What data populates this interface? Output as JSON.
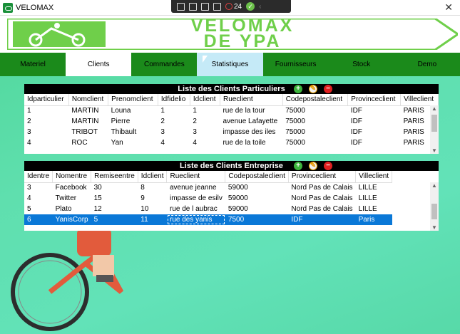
{
  "window": {
    "title": "VELOMAX",
    "close_label": "✕",
    "debug_count": "24"
  },
  "banner": {
    "line1": "VELOMAX",
    "line2": "DE YPA"
  },
  "nav": {
    "tabs": [
      {
        "label": "Materiel"
      },
      {
        "label": "Clients"
      },
      {
        "label": "Commandes"
      },
      {
        "label": "Statistiques"
      },
      {
        "label": "Fournisseurs"
      },
      {
        "label": "Stock"
      },
      {
        "label": "Demo"
      }
    ]
  },
  "particuliers": {
    "title": "Liste des Clients Particuliers",
    "columns": [
      "Idparticulier",
      "Nomclient",
      "Prenomclient",
      "Idfidelio",
      "Idclient",
      "Rueclient",
      "Codepostaleclient",
      "Provinceclient",
      "Villeclient"
    ],
    "rows": [
      [
        "1",
        "MARTIN",
        "Louna",
        "1",
        "1",
        "rue de la tour",
        "75000",
        "IDF",
        "PARIS"
      ],
      [
        "2",
        "MARTIN",
        "Pierre",
        "2",
        "2",
        "avenue Lafayette",
        "75000",
        "IDF",
        "PARIS"
      ],
      [
        "3",
        "TRIBOT",
        "Thibault",
        "3",
        "3",
        "impasse des iles",
        "75000",
        "IDF",
        "PARIS"
      ],
      [
        "4",
        "ROC",
        "Yan",
        "4",
        "4",
        "rue de la toile",
        "75000",
        "IDF",
        "PARIS"
      ]
    ]
  },
  "entreprises": {
    "title": "Liste des Clients Entreprise",
    "columns": [
      "Identre",
      "Nomentre",
      "Remiseentre",
      "Idclient",
      "Rueclient",
      "Codepostaleclient",
      "Provinceclient",
      "Villeclient"
    ],
    "rows": [
      [
        "3",
        "Facebook",
        "30",
        "8",
        "avenue jeanne",
        "59000",
        "Nord Pas de Calais",
        "LILLE"
      ],
      [
        "4",
        "Twitter",
        "15",
        "9",
        "impasse de esilv",
        "59000",
        "Nord Pas de Calais",
        "LILLE"
      ],
      [
        "5",
        "Plato",
        "12",
        "10",
        "rue de l aubrac",
        "59000",
        "Nord Pas de Calais",
        "LILLE"
      ],
      [
        "6",
        "YanisCorp",
        "5",
        "11",
        "rue des yanis",
        "7500",
        "IDF",
        "Paris"
      ]
    ],
    "selected_row": 3
  },
  "icons": {
    "add": "add-icon",
    "edit": "edit-icon",
    "delete": "delete-icon"
  },
  "colors": {
    "nav_green": "#1b8a1b",
    "selected_blue": "#0a78d7",
    "banner_green": "#6fcf4a"
  }
}
